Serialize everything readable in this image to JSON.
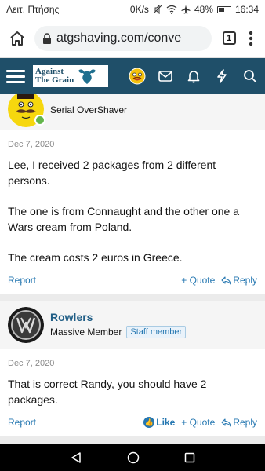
{
  "status_bar": {
    "carrier": "Λειτ. Πτήσης",
    "speed": "0K/s",
    "battery": "48%",
    "battery_level": 0.48,
    "time": "16:34"
  },
  "browser": {
    "url": "atgshaving.com/conve",
    "tab_count": "1"
  },
  "site_header": {
    "logo_line1": "Against",
    "logo_line2": "The Grain",
    "icons": [
      "menu-icon",
      "reaction-icon",
      "inbox-icon",
      "bell-icon",
      "bolt-icon",
      "search-icon"
    ]
  },
  "posts": [
    {
      "username": "",
      "user_title": "Serial OverShaver",
      "date": "Dec 7, 2020",
      "body": [
        "Lee, I received 2 packages from 2 different persons.",
        "The one is from Connaught and the other one a Wars cream from Poland.",
        "The cream costs 2 euros in Greece."
      ],
      "actions": {
        "report": "Report",
        "quote": "+ Quote",
        "reply": "Reply"
      }
    },
    {
      "username": "Rowlers",
      "user_title": "Massive Member",
      "badge": "Staff member",
      "date": "Dec 7, 2020",
      "body": [
        "That is correct Randy, you should have 2 packages."
      ],
      "actions": {
        "report": "Report",
        "like": "Like",
        "quote": "+ Quote",
        "reply": "Reply"
      }
    }
  ],
  "colors": {
    "header": "#1f4f69",
    "link": "#2577b1",
    "username": "#1f5d85"
  }
}
